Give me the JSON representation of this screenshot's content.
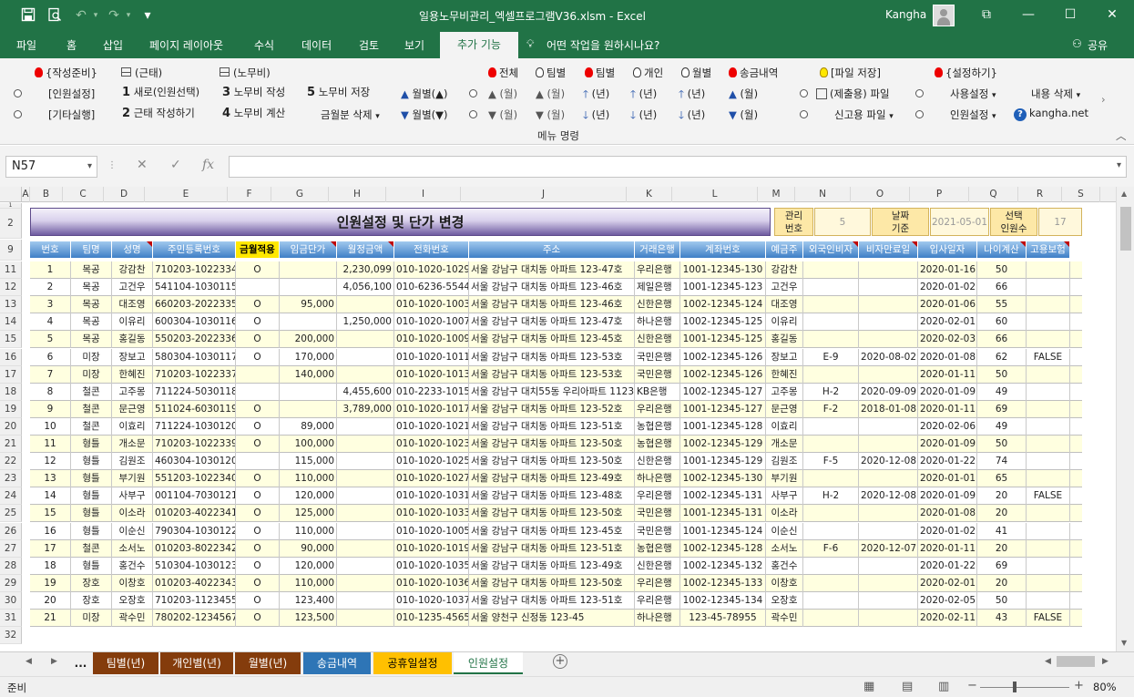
{
  "window": {
    "title": "일용노무비관리_엑셀프로그램V36.xlsm  -  Excel",
    "user": "Kangha"
  },
  "ribbon_tabs": [
    "파일",
    "홈",
    "삽입",
    "페이지 레이아웃",
    "수식",
    "데이터",
    "검토",
    "보기",
    "추가 기능"
  ],
  "tell_me": "어떤 작업을 원하시나요?",
  "share_label": "공유",
  "ribbon": {
    "prep": "{작성준비}",
    "attend": "(근태)",
    "labor": "(노무비)",
    "staff_settings": "[인원설정]",
    "other_run": "[기타실행]",
    "step1": "1",
    "step1_label": "새로(인원선택)",
    "step2": "2",
    "step2_label": "근태 작성하기",
    "step3": "3",
    "step3_label": "노무비 작성",
    "step4": "4",
    "step4_label": "노무비 계산",
    "step5": "5",
    "step5_label": "노무비 저장",
    "month_delete": "금월분 삭제",
    "all": "전체",
    "by_team": "팀별",
    "by_team2": "팀별",
    "personal": "개인",
    "monthly": "월별",
    "transfer": "송금내역",
    "monthly_up": "월별(▲)",
    "monthly_down": "월별(▼)",
    "month_m": "(월)",
    "year_n": "(년)",
    "file_save": "[파일 저장]",
    "settings": "{설정하기}",
    "submit_file": "(제출용) 파일",
    "report_file": "신고용 파일",
    "use_settings": "사용설정",
    "staff_set": "인원설정",
    "content_delete": "내용 삭제",
    "site": "kangha.net",
    "group_label": "메뉴 명령"
  },
  "formula_bar": {
    "name_box": "N57",
    "fx": "fx",
    "cancel": "✕",
    "confirm": "✓"
  },
  "columns": [
    "A",
    "B",
    "C",
    "D",
    "E",
    "F",
    "G",
    "H",
    "I",
    "J",
    "K",
    "L",
    "M",
    "N",
    "O",
    "P",
    "Q",
    "R",
    "S"
  ],
  "row_numbers": [
    "1",
    "2",
    "9",
    "11",
    "12",
    "13",
    "14",
    "15",
    "16",
    "17",
    "18",
    "19",
    "20",
    "21",
    "22",
    "23",
    "24",
    "25",
    "26",
    "27",
    "28",
    "29",
    "30",
    "31",
    "32"
  ],
  "sheet": {
    "banner": "인원설정 및 단가 변경",
    "mgmt_label": "관리\n번호",
    "mgmt_value": "5",
    "date_label": "날짜\n기준",
    "date_value": "2021-05-01",
    "sel_label": "선택\n인원수",
    "sel_value": "17",
    "headers": [
      "번호",
      "팀명",
      "성명",
      "주민등록번호",
      "금월적용",
      "임금단가",
      "월정금액",
      "전화번호",
      "주소",
      "거래은행",
      "계좌번호",
      "예금주",
      "외국인비자",
      "비자만료일",
      "입사일자",
      "나이계산",
      "고용보험"
    ],
    "rows": [
      [
        "1",
        "목공",
        "강감찬",
        "710203-1022334",
        "O",
        "",
        "2,230,099",
        "010-1020-1029",
        "서울 강남구 대치동 아파트 123-47호",
        "우리은행",
        "1001-12345-130",
        "강감찬",
        "",
        "",
        "2020-01-16",
        "50",
        ""
      ],
      [
        "2",
        "목공",
        "고건우",
        "541104-1030115",
        "",
        "",
        "4,056,100",
        "010-6236-5544",
        "서울 강남구 대치동 아파트 123-46호",
        "제일은행",
        "1001-12345-123",
        "고건우",
        "",
        "",
        "2020-01-02",
        "66",
        ""
      ],
      [
        "3",
        "목공",
        "대조영",
        "660203-2022335",
        "O",
        "95,000",
        "",
        "010-1020-1003",
        "서울 강남구 대치동 아파트 123-46호",
        "신한은행",
        "1002-12345-124",
        "대조영",
        "",
        "",
        "2020-01-06",
        "55",
        ""
      ],
      [
        "4",
        "목공",
        "이유리",
        "600304-1030116",
        "O",
        "",
        "1,250,000",
        "010-1020-1007",
        "서울 강남구 대치동 아파트 123-47호",
        "하나은행",
        "1002-12345-125",
        "이유리",
        "",
        "",
        "2020-02-01",
        "60",
        ""
      ],
      [
        "5",
        "목공",
        "홍길동",
        "550203-2022336",
        "O",
        "200,000",
        "",
        "010-1020-1009",
        "서울 강남구 대치동 아파트 123-45호",
        "신한은행",
        "1001-12345-125",
        "홍길동",
        "",
        "",
        "2020-02-03",
        "66",
        ""
      ],
      [
        "6",
        "미장",
        "장보고",
        "580304-1030117",
        "O",
        "170,000",
        "",
        "010-1020-1011",
        "서울 강남구 대치동 아파트 123-53호",
        "국민은행",
        "1002-12345-126",
        "장보고",
        "E-9",
        "2020-08-02",
        "2020-01-08",
        "62",
        "FALSE"
      ],
      [
        "7",
        "미장",
        "한혜진",
        "710203-1022337",
        "",
        "140,000",
        "",
        "010-1020-1013",
        "서울 강남구 대치동 아파트 123-53호",
        "국민은행",
        "1002-12345-126",
        "한혜진",
        "",
        "",
        "2020-01-11",
        "50",
        ""
      ],
      [
        "8",
        "철콘",
        "고주몽",
        "711224-5030118",
        "",
        "",
        "4,455,600",
        "010-2233-1015",
        "서울 강남구 대치55동 우리아파트 1123",
        "KB은행",
        "1002-12345-127",
        "고주몽",
        "H-2",
        "2020-09-09",
        "2020-01-09",
        "49",
        ""
      ],
      [
        "9",
        "철콘",
        "문근영",
        "511024-6030119",
        "O",
        "",
        "3,789,000",
        "010-1020-1017",
        "서울 강남구 대치동 아파트 123-52호",
        "우리은행",
        "1001-12345-127",
        "문근영",
        "F-2",
        "2018-01-08",
        "2020-01-11",
        "69",
        ""
      ],
      [
        "10",
        "철콘",
        "이효리",
        "711224-1030120",
        "O",
        "89,000",
        "",
        "010-1020-1021",
        "서울 강남구 대치동 아파트 123-51호",
        "농협은행",
        "1001-12345-128",
        "이효리",
        "",
        "",
        "2020-02-06",
        "49",
        ""
      ],
      [
        "11",
        "형틀",
        "개소문",
        "710203-1022339",
        "O",
        "100,000",
        "",
        "010-1020-1023",
        "서울 강남구 대치동 아파트 123-50호",
        "농협은행",
        "1002-12345-129",
        "개소문",
        "",
        "",
        "2020-01-09",
        "50",
        ""
      ],
      [
        "12",
        "형틀",
        "김원조",
        "460304-1030120",
        "",
        "115,000",
        "",
        "010-1020-1025",
        "서울 강남구 대치동 아파트 123-50호",
        "신한은행",
        "1001-12345-129",
        "김원조",
        "F-5",
        "2020-12-08",
        "2020-01-22",
        "74",
        ""
      ],
      [
        "13",
        "형틀",
        "부기원",
        "551203-1022340",
        "O",
        "110,000",
        "",
        "010-1020-1027",
        "서울 강남구 대치동 아파트 123-49호",
        "하나은행",
        "1002-12345-130",
        "부기원",
        "",
        "",
        "2020-01-01",
        "65",
        ""
      ],
      [
        "14",
        "형틀",
        "사부구",
        "001104-7030121",
        "O",
        "120,000",
        "",
        "010-1020-1031",
        "서울 강남구 대치동 아파트 123-48호",
        "우리은행",
        "1002-12345-131",
        "사부구",
        "H-2",
        "2020-12-08",
        "2020-01-09",
        "20",
        "FALSE"
      ],
      [
        "15",
        "형틀",
        "이소라",
        "010203-4022341",
        "O",
        "125,000",
        "",
        "010-1020-1033",
        "서울 강남구 대치동 아파트 123-50호",
        "국민은행",
        "1001-12345-131",
        "이소라",
        "",
        "",
        "2020-01-08",
        "20",
        ""
      ],
      [
        "16",
        "형틀",
        "이순신",
        "790304-1030122",
        "O",
        "110,000",
        "",
        "010-1020-1005",
        "서울 강남구 대치동 아파트 123-45호",
        "국민은행",
        "1001-12345-124",
        "이순신",
        "",
        "",
        "2020-01-02",
        "41",
        ""
      ],
      [
        "17",
        "철콘",
        "소서노",
        "010203-8022342",
        "O",
        "90,000",
        "",
        "010-1020-1019",
        "서울 강남구 대치동 아파트 123-51호",
        "농협은행",
        "1002-12345-128",
        "소서노",
        "F-6",
        "2020-12-07",
        "2020-01-11",
        "20",
        ""
      ],
      [
        "18",
        "형틀",
        "홍건수",
        "510304-1030123",
        "O",
        "120,000",
        "",
        "010-1020-1035",
        "서울 강남구 대치동 아파트 123-49호",
        "신한은행",
        "1002-12345-132",
        "홍건수",
        "",
        "",
        "2020-01-22",
        "69",
        ""
      ],
      [
        "19",
        "장호",
        "이창호",
        "010203-4022343",
        "O",
        "110,000",
        "",
        "010-1020-1036",
        "서울 강남구 대치동 아파트 123-50호",
        "우리은행",
        "1002-12345-133",
        "이창호",
        "",
        "",
        "2020-02-01",
        "20",
        ""
      ],
      [
        "20",
        "장호",
        "오장호",
        "710203-1123455",
        "O",
        "123,400",
        "",
        "010-1020-1037",
        "서울 강남구 대치동 아파트 123-51호",
        "우리은행",
        "1002-12345-134",
        "오장호",
        "",
        "",
        "2020-02-05",
        "50",
        ""
      ],
      [
        "21",
        "미장",
        "곽수민",
        "780202-1234567",
        "O",
        "123,500",
        "",
        "010-1235-4565",
        "서울 양천구 신정동 123-45",
        "하나은행",
        "123-45-78955",
        "곽수민",
        "",
        "",
        "2020-02-11",
        "43",
        "FALSE"
      ]
    ]
  },
  "sheet_tabs": [
    "...",
    "팀별(년)",
    "개인별(년)",
    "월별(년)",
    "송금내역",
    "공휴일설정",
    "인원설정"
  ],
  "status": {
    "ready": "준비",
    "zoom": "80%"
  },
  "colors": {
    "excel_green": "#217346",
    "tab_brown": "#843c0c",
    "tab_teal": "#2e75b6",
    "tab_gold": "#ffc000"
  }
}
